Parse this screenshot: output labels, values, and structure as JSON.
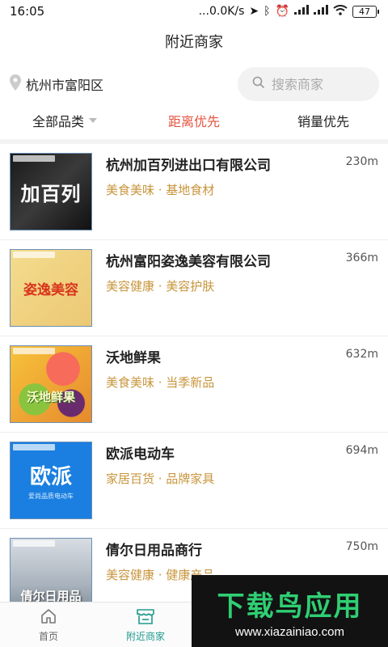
{
  "status_bar": {
    "time": "16:05",
    "network_speed": "...0.0K/s",
    "battery": "47"
  },
  "header": {
    "title": "附近商家"
  },
  "location": {
    "text": "杭州市富阳区"
  },
  "search": {
    "placeholder": "搜索商家",
    "value": ""
  },
  "filters": [
    {
      "label": "全部品类",
      "has_dropdown": true,
      "active": false
    },
    {
      "label": "距离优先",
      "active": true
    },
    {
      "label": "销量优先",
      "active": false
    }
  ],
  "merchants": [
    {
      "name": "杭州加百列进出口有限公司",
      "distance": "230m",
      "categories": "美食美味 · 基地食材",
      "thumb_text": "加百列"
    },
    {
      "name": "杭州富阳姿逸美容有限公司",
      "distance": "366m",
      "categories": "美容健康 · 美容护肤",
      "thumb_text": "姿逸美容"
    },
    {
      "name": "沃地鲜果",
      "distance": "632m",
      "categories": "美食美味 · 当季新品",
      "thumb_text": "沃地鲜果"
    },
    {
      "name": "欧派电动车",
      "distance": "694m",
      "categories": "家居百货 · 品牌家具",
      "thumb_text": "欧派",
      "thumb_sub": "爱尚品质电动车"
    },
    {
      "name": "倩尔日用品商行",
      "distance": "750m",
      "categories": "美容健康 · 健康产品",
      "thumb_text": "倩尔日用品"
    }
  ],
  "tabs": [
    {
      "label": "首页",
      "icon": "home-icon",
      "active": false
    },
    {
      "label": "附近商家",
      "icon": "store-icon",
      "active": true
    }
  ],
  "watermark": {
    "title": "下载鸟应用",
    "url": "www.xiazainiao.com"
  },
  "colors": {
    "accent_red": "#e5533f",
    "category_gold": "#c8963e",
    "tab_active": "#1f9b8e"
  }
}
